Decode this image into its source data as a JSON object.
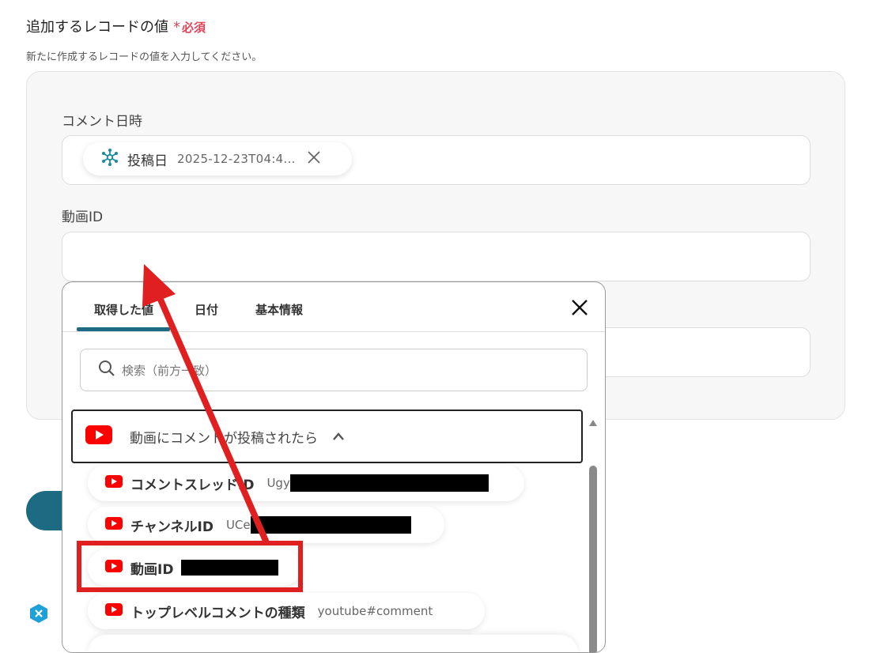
{
  "section": {
    "title": "追加するレコードの値",
    "required_mark": "*",
    "required_label": "必須",
    "description": "新たに作成するレコードの値を入力してください。"
  },
  "fields": {
    "comment_datetime": {
      "label": "コメント日時",
      "chip_label": "投稿日",
      "chip_value": "2025-12-23T04:4..."
    },
    "video_id": {
      "label": "動画ID"
    }
  },
  "popup": {
    "tabs": [
      "取得した値",
      "日付",
      "基本情報"
    ],
    "search_placeholder": "検索（前方一致）",
    "group_title": "動画にコメントが投稿されたら",
    "items": [
      {
        "label": "コメントスレッドID",
        "value": "Ugy"
      },
      {
        "label": "チャンネルID",
        "value": "UCe"
      },
      {
        "label": "動画ID",
        "value": ""
      },
      {
        "label": "トップレベルコメントの種類",
        "value": "youtube#comment"
      }
    ]
  },
  "colors": {
    "accent": "#1d6b82",
    "required": "#e0455a",
    "annotation_red": "#e02020",
    "youtube_red": "#ff0000"
  }
}
